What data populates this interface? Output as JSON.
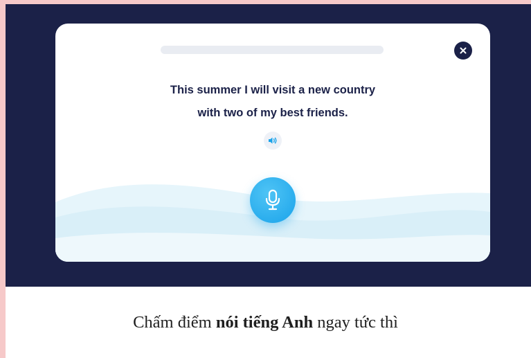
{
  "exercise": {
    "progress_fraction": 0,
    "sentence_line1": "This summer I will visit a new country",
    "sentence_line2": "with two of my best friends.",
    "icons": {
      "close": "close-icon",
      "speaker": "speaker-icon",
      "microphone": "microphone-icon"
    },
    "colors": {
      "navy": "#1b2148",
      "mic_blue": "#1aa3ea",
      "outer_border": "#f6c9c9"
    }
  },
  "caption": {
    "prefix": "Chấm điểm ",
    "bold": "nói tiếng Anh",
    "suffix": " ngay tức thì"
  }
}
